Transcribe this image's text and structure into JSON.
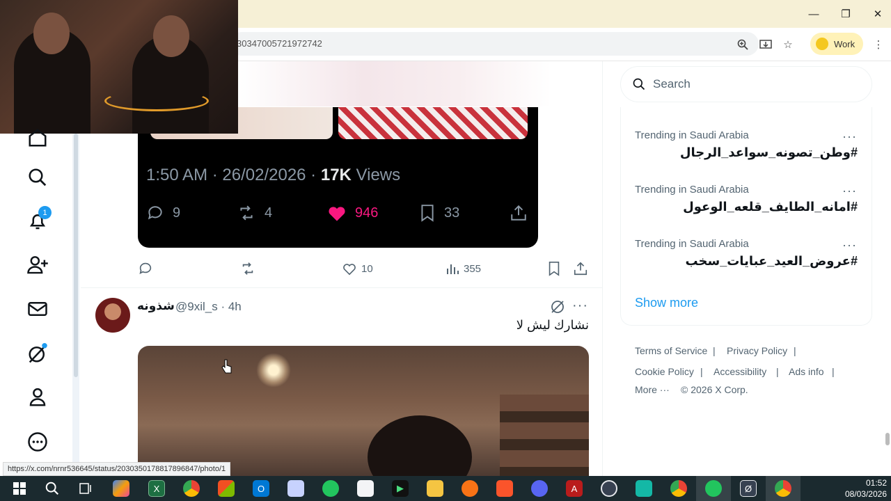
{
  "browser": {
    "url_visible": "3034700572197274​2",
    "profile_label": "Work",
    "window_controls": [
      "minimize",
      "restore",
      "close"
    ]
  },
  "status_bar_url": "https://x.com/nrnr536645/status/2030350178817896847/photo/1",
  "nav": {
    "notification_count": "1",
    "items": [
      "home-icon",
      "search-icon",
      "bell-icon",
      "person-add-icon",
      "mail-icon",
      "grok-icon",
      "profile-icon",
      "more-icon"
    ]
  },
  "quoted_post": {
    "time": "1:50 AM",
    "date": "26/02/2026",
    "views_count": "17K",
    "views_label": "Views",
    "replies": "9",
    "reposts": "4",
    "likes": "946",
    "bookmarks": "33",
    "colors": {
      "like": "#f91880",
      "bg": "#000000"
    }
  },
  "post_actions": {
    "likes": "10",
    "views": "355"
  },
  "next_post": {
    "name": "شذونه",
    "handle": "@9xil_s",
    "age": "· 4h",
    "text": "نشارك ليش لا"
  },
  "sidebar": {
    "search_placeholder": "Search",
    "trends": [
      {
        "context": "Trending in Saudi Arabia",
        "tag": "#وطن_تصونه_سواعد_الرجال"
      },
      {
        "context": "Trending in Saudi Arabia",
        "tag": "#امانه_الطايف_قلعه_الوعول"
      },
      {
        "context": "Trending in Saudi Arabia",
        "tag": "#عروض_العيد_عبايات_سخب"
      }
    ],
    "show_more": "Show more",
    "footer": {
      "terms": "Terms of Service",
      "privacy": "Privacy Policy",
      "cookie": "Cookie Policy",
      "accessibility": "Accessibility",
      "ads": "Ads info",
      "more": "More ···",
      "copyright": "© 2026 X Corp."
    },
    "accent": "#1d9bf0"
  },
  "taskbar": {
    "time": "01:52",
    "date": "08/03/2026"
  }
}
